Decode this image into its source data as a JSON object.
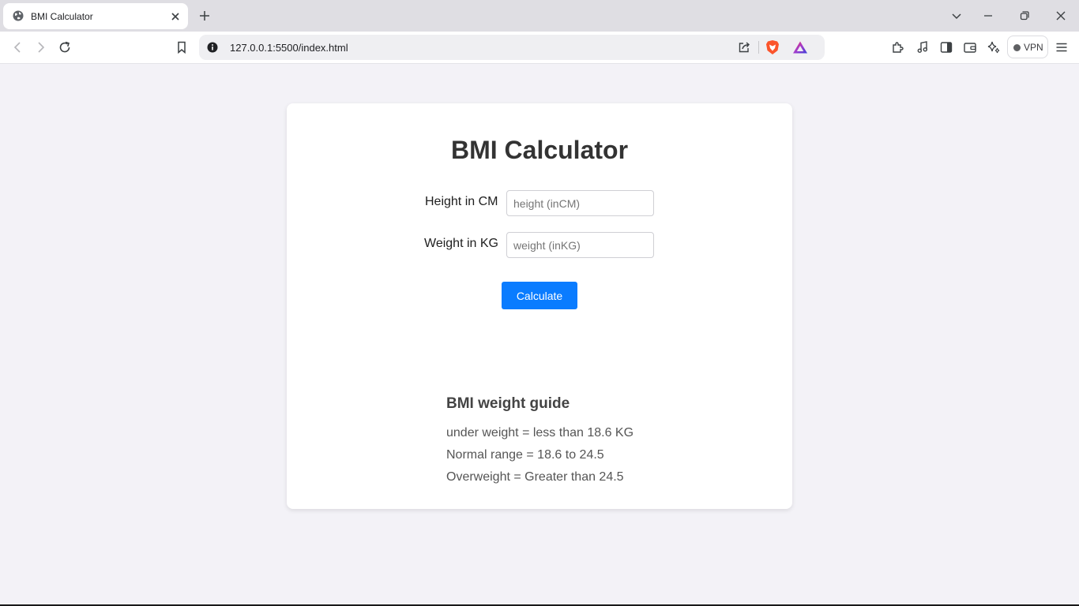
{
  "browser": {
    "tab": {
      "title": "BMI Calculator"
    },
    "address_bar": {
      "url": "127.0.0.1:5500/index.html"
    },
    "vpn_label": "VPN"
  },
  "page": {
    "title": "BMI Calculator",
    "height_field": {
      "label": "Height in CM",
      "placeholder": "height (inCM)",
      "value": ""
    },
    "weight_field": {
      "label": "Weight in KG",
      "placeholder": "weight (inKG)",
      "value": ""
    },
    "calculate_label": "Calculate",
    "result": "",
    "guide": {
      "title": "BMI weight guide",
      "lines": [
        "under weight = less than 18.6 KG",
        "Normal range = 18.6 to 24.5",
        "Overweight = Greater than 24.5"
      ]
    }
  },
  "colors": {
    "accent_button": "#0a7cff",
    "page_background": "#f3f2f7",
    "card_background": "#ffffff",
    "brave_orange": "#fb542b"
  },
  "icons": [
    "globe-icon",
    "close-icon",
    "plus-icon",
    "chevron-down-icon",
    "minimize-icon",
    "restore-icon",
    "back-icon",
    "forward-icon",
    "reload-icon",
    "bookmark-icon",
    "info-icon",
    "share-icon",
    "brave-shield-icon",
    "brave-rewards-icon",
    "extensions-icon",
    "music-icon",
    "sidebar-icon",
    "wallet-icon",
    "leo-ai-icon",
    "menu-icon"
  ]
}
